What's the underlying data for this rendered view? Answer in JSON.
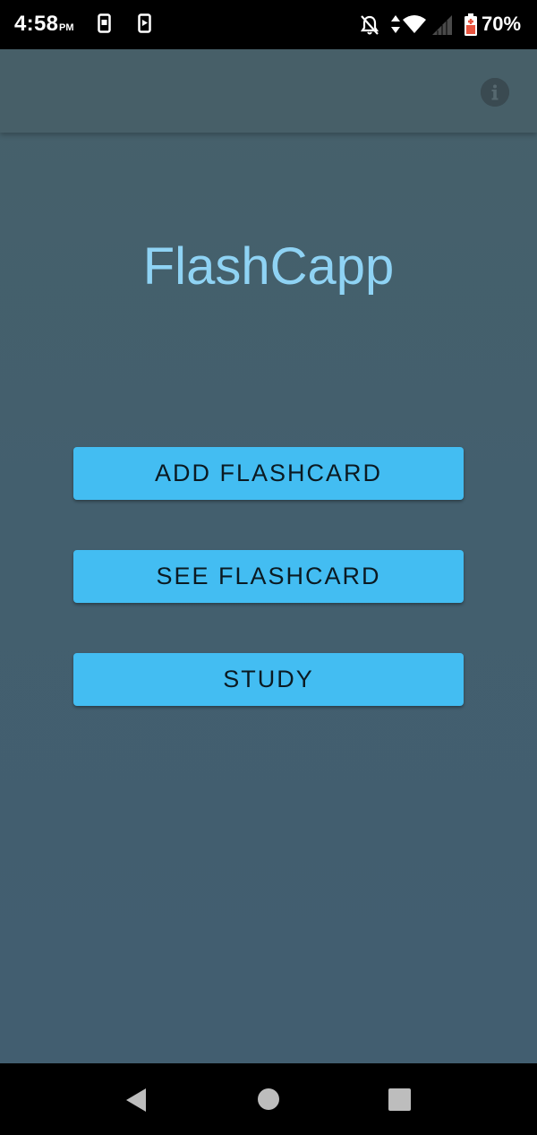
{
  "status_bar": {
    "time": "4:58",
    "ampm": "PM",
    "battery_percent": "70%",
    "icons": [
      "phone-notification-icon",
      "phone-notification-icon",
      "do-not-disturb-bell-off-icon",
      "data-arrows-icon",
      "wifi-icon",
      "cellular-signal-icon",
      "battery-saver-icon"
    ]
  },
  "app_bar": {
    "info_icon": "info-icon"
  },
  "main": {
    "title": "FlashCapp",
    "buttons": [
      {
        "label": "ADD FLASHCARD"
      },
      {
        "label": "SEE FLASHCARD"
      },
      {
        "label": "STUDY"
      }
    ]
  },
  "nav_bar": {
    "icons": [
      "back-triangle-icon",
      "home-circle-icon",
      "recents-square-icon"
    ]
  },
  "colors": {
    "title": "#8fd3f4",
    "button": "#43bdf2",
    "background": "#445f6c",
    "battery_accent": "#e8543f"
  }
}
